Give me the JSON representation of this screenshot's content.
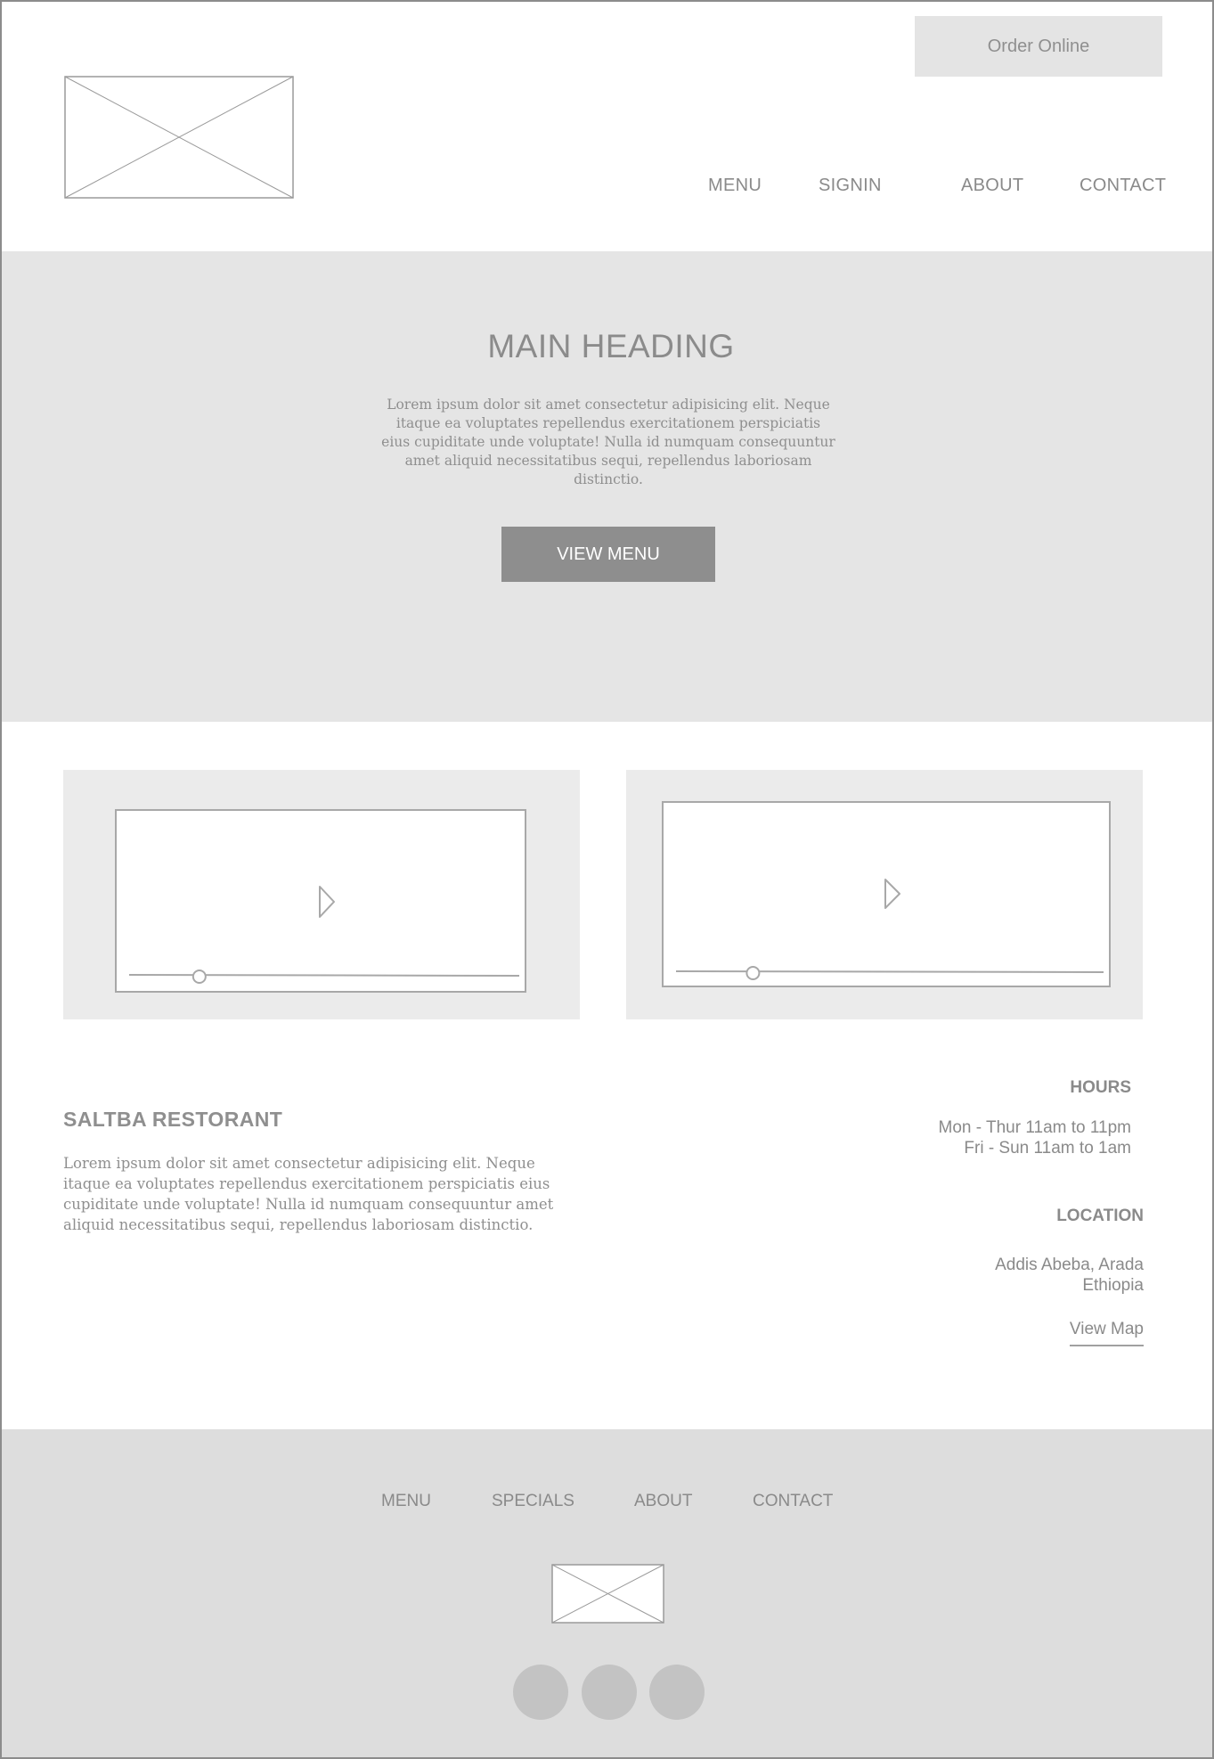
{
  "header": {
    "order_label": "Order Online",
    "nav": [
      "MENU",
      "SIGNIN",
      "ABOUT",
      "CONTACT"
    ]
  },
  "hero": {
    "heading": "MAIN HEADING",
    "text": "Lorem ipsum dolor sit amet consectetur adipisicing elit. Neque itaque ea voluptates repellendus exercitationem perspiciatis eius cupiditate unde voluptate! Nulla id numquam consequuntur amet aliquid necessitatibus sequi, repellendus laboriosam distinctio.",
    "button_label": "VIEW MENU"
  },
  "videos": [
    {
      "progress": 0.18
    },
    {
      "progress": 0.18
    }
  ],
  "about": {
    "title": "SALTBA RESTORANT",
    "text": "Lorem ipsum dolor sit amet consectetur adipisicing elit. Neque itaque ea voluptates repellendus exercitationem perspiciatis eius cupiditate unde voluptate! Nulla id numquam consequuntur amet aliquid necessitatibus sequi, repellendus laboriosam distinctio."
  },
  "hours": {
    "title": "HOURS",
    "lines": [
      "Mon - Thur 11am to 11pm",
      "Fri - Sun 11am to 1am"
    ]
  },
  "location": {
    "title": "LOCATION",
    "lines": [
      "Addis Abeba, Arada",
      "Ethiopia"
    ],
    "map_link": "View Map"
  },
  "footer": {
    "nav": [
      "MENU",
      "SPECIALS",
      "ABOUT",
      "CONTACT"
    ]
  },
  "colors": {
    "hero_bg": "#e5e5e5",
    "button_bg": "#8e8e8e",
    "footer_bg": "#dddddd"
  },
  "icons": [
    "logo-placeholder-icon",
    "play-icon",
    "social-icon"
  ]
}
